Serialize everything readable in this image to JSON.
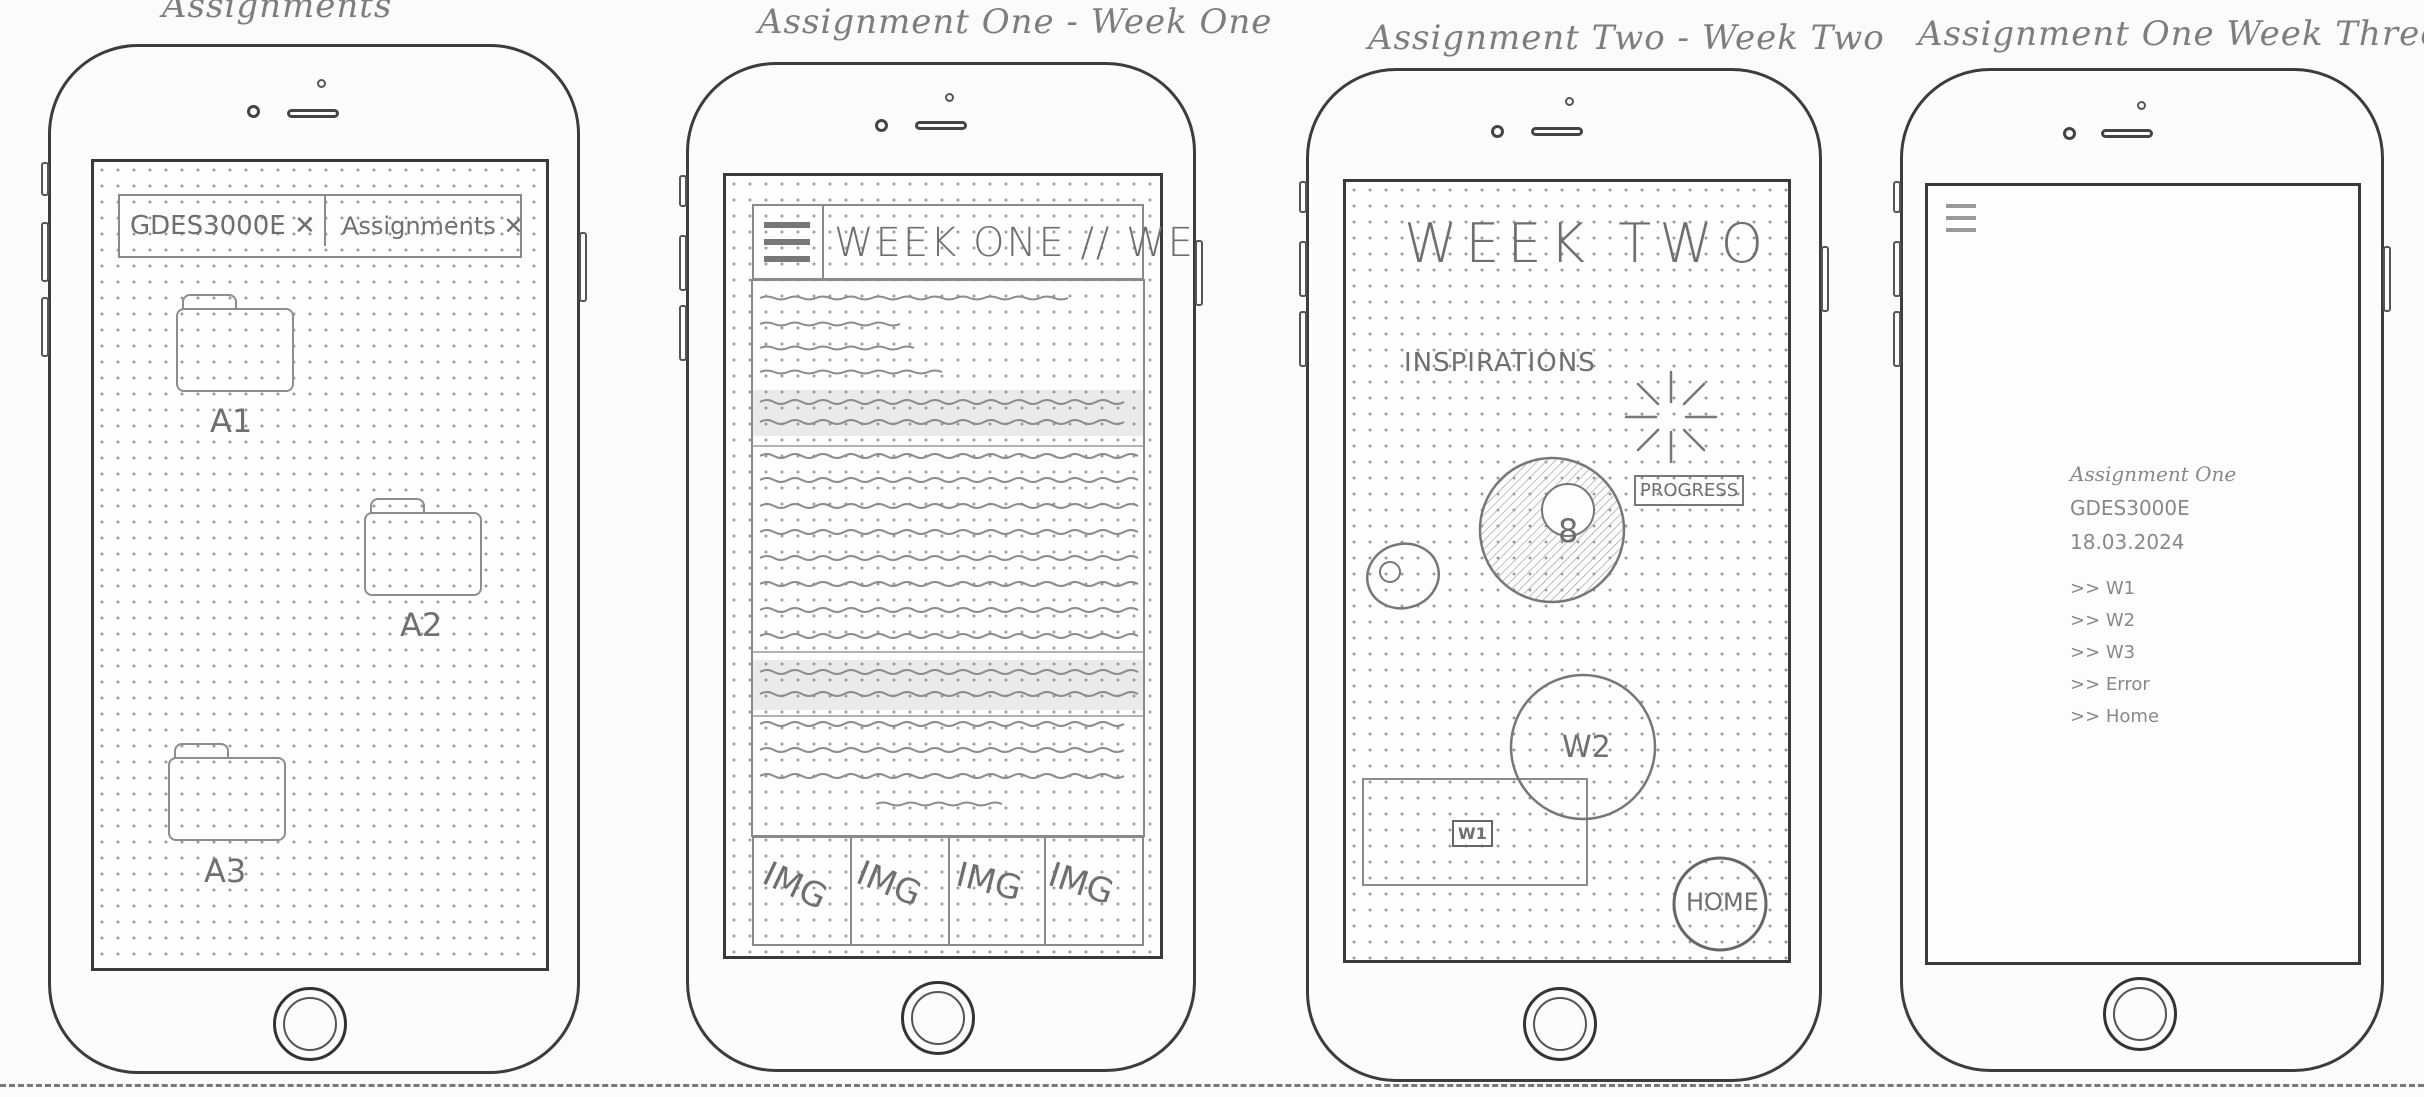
{
  "captions": {
    "s1": "Assignments",
    "s2": "Assignment One - Week One",
    "s3": "Assignment Two - Week Two",
    "s4": "Assignment One  Week Three"
  },
  "screen1": {
    "tab1": "GDES3000E ✕",
    "tab2": "Assignments ✕",
    "folders": [
      "A1",
      "A2",
      "A3"
    ]
  },
  "screen2": {
    "header": "WEEK ONE // WE",
    "images": [
      "IMG",
      "IMG",
      "IMG",
      "IMG"
    ]
  },
  "screen3": {
    "title": "WEEK TWO",
    "section": "INSPIRATIONS",
    "progress": "PROGRESS",
    "ball": "8",
    "circle": "W2",
    "small_label": "W1",
    "home": "HOME"
  },
  "screen4": {
    "lines": [
      "Assignment One",
      "GDES3000E",
      "18.03.2024"
    ],
    "menu": [
      ">> W1",
      ">> W2",
      ">> W3",
      ">> Error",
      ">> Home"
    ]
  },
  "colors": {
    "ink": "#3c3c3c",
    "pencil": "#8a8a8a",
    "paper": "#fbfbfa"
  }
}
